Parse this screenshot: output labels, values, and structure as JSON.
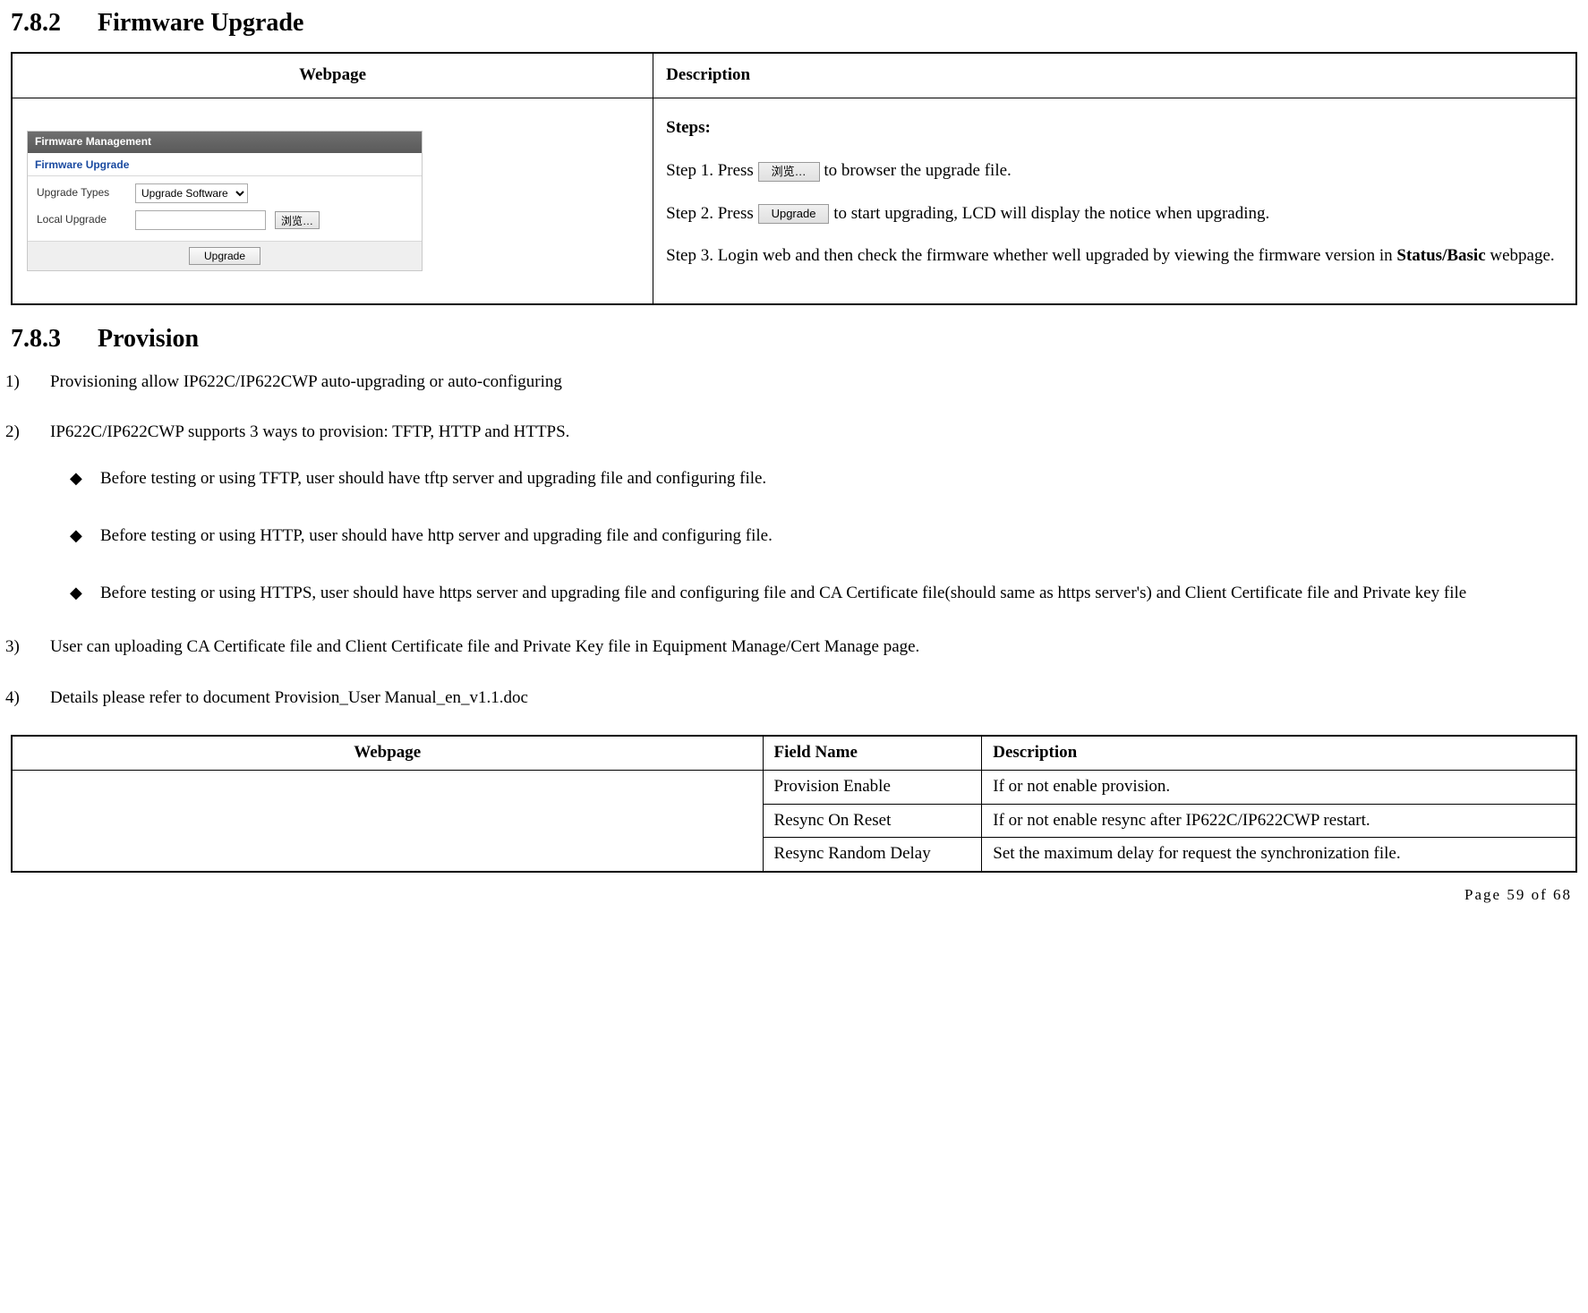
{
  "section1": {
    "number": "7.8.2",
    "title": "Firmware Upgrade"
  },
  "table1_headers": {
    "webpage": "Webpage",
    "description": "Description"
  },
  "fm": {
    "panel_title": "Firmware Management",
    "subtitle": "Firmware Upgrade",
    "row1_label": "Upgrade Types",
    "row1_value": "Upgrade Software",
    "row2_label": "Local Upgrade",
    "row2_value": "",
    "browse_label": "浏览…",
    "upgrade_label": "Upgrade"
  },
  "desc1": {
    "steps_heading": "Steps:",
    "step1_prefix": "Step 1. Press ",
    "step1_button": "浏览…",
    "step1_suffix": "  to browser the upgrade file.",
    "step2_prefix": "Step  2.  Press ",
    "step2_button": "Upgrade",
    "step2_suffix": "  to  start  upgrading,  LCD  will  display  the  notice  when upgrading.",
    "step3": "Step 3. Login web and then check the firmware whether well upgraded by viewing the firmware version in ",
    "step3_bold": "Status/Basic",
    "step3_tail": " webpage."
  },
  "section2": {
    "number": "7.8.3",
    "title": "Provision"
  },
  "list": {
    "n1": "1)",
    "t1": "Provisioning allow IP622C/IP622CWP auto-upgrading or auto-configuring",
    "n2": "2)",
    "t2": "IP622C/IP622CWP supports 3 ways to provision: TFTP, HTTP and HTTPS.",
    "b1": "Before testing or using TFTP, user should have tftp server and upgrading file and configuring file.",
    "b2": "Before testing or using HTTP, user should have http server and upgrading file and configuring file.",
    "b3": "Before testing or using HTTPS, user should have https server and upgrading file and configuring file and CA Certificate file(should same as https server's) and Client Certificate file and Private key file",
    "n3": "3)",
    "t3": "User can uploading CA Certificate file and Client Certificate file and Private Key file in Equipment Manage/Cert Manage page.",
    "n4": "4)",
    "t4": "Details please refer to document Provision_User Manual_en_v1.1.doc"
  },
  "table2_headers": {
    "webpage": "Webpage",
    "field": "Field Name",
    "description": "Description"
  },
  "table2_rows": [
    {
      "field": "Provision Enable",
      "desc": "If or not enable provision."
    },
    {
      "field": "Resync On Reset",
      "desc": "If or not enable resync after IP622C/IP622CWP restart."
    },
    {
      "field": "Resync Random Delay",
      "desc": "Set the maximum delay for request the synchronization file."
    }
  ],
  "footer": "Page  59  of  68"
}
